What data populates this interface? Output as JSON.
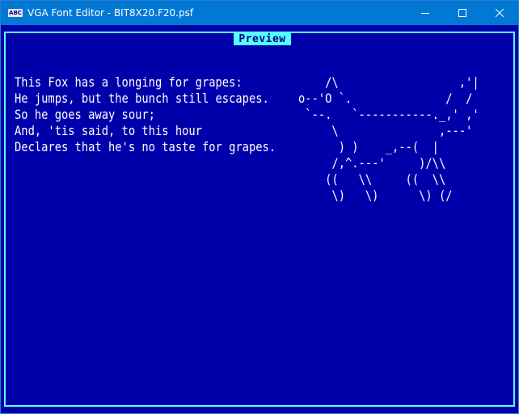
{
  "window": {
    "app_icon_text": "ABC",
    "title": "VGA Font Editor - BIT8X20.F20.psf",
    "controls": {
      "minimize": "minimize-icon",
      "maximize": "maximize-icon",
      "close": "close-icon"
    }
  },
  "preview": {
    "title": "Preview",
    "poem": [
      "This Fox has a longing for grapes:",
      "He jumps, but the bunch still escapes.",
      "So he goes away sour;",
      "And, 'tis said, to this hour",
      "Declares that he's no taste for grapes."
    ],
    "art": [
      "    /\\                  ,'|",
      "o--'O `.              /  /",
      " `--.   `-----------._,' ,'",
      "     \\               ,---'",
      "      ) )    _,--(  |",
      "     /,^.---'     )/\\\\",
      "    ((   \\\\     ((  \\\\",
      "     \\)   \\)      \\) (/"
    ]
  },
  "colors": {
    "background": "#0000aa",
    "frame": "#55ffff",
    "text": "#ffffff",
    "titlebar": "#0078d4"
  }
}
